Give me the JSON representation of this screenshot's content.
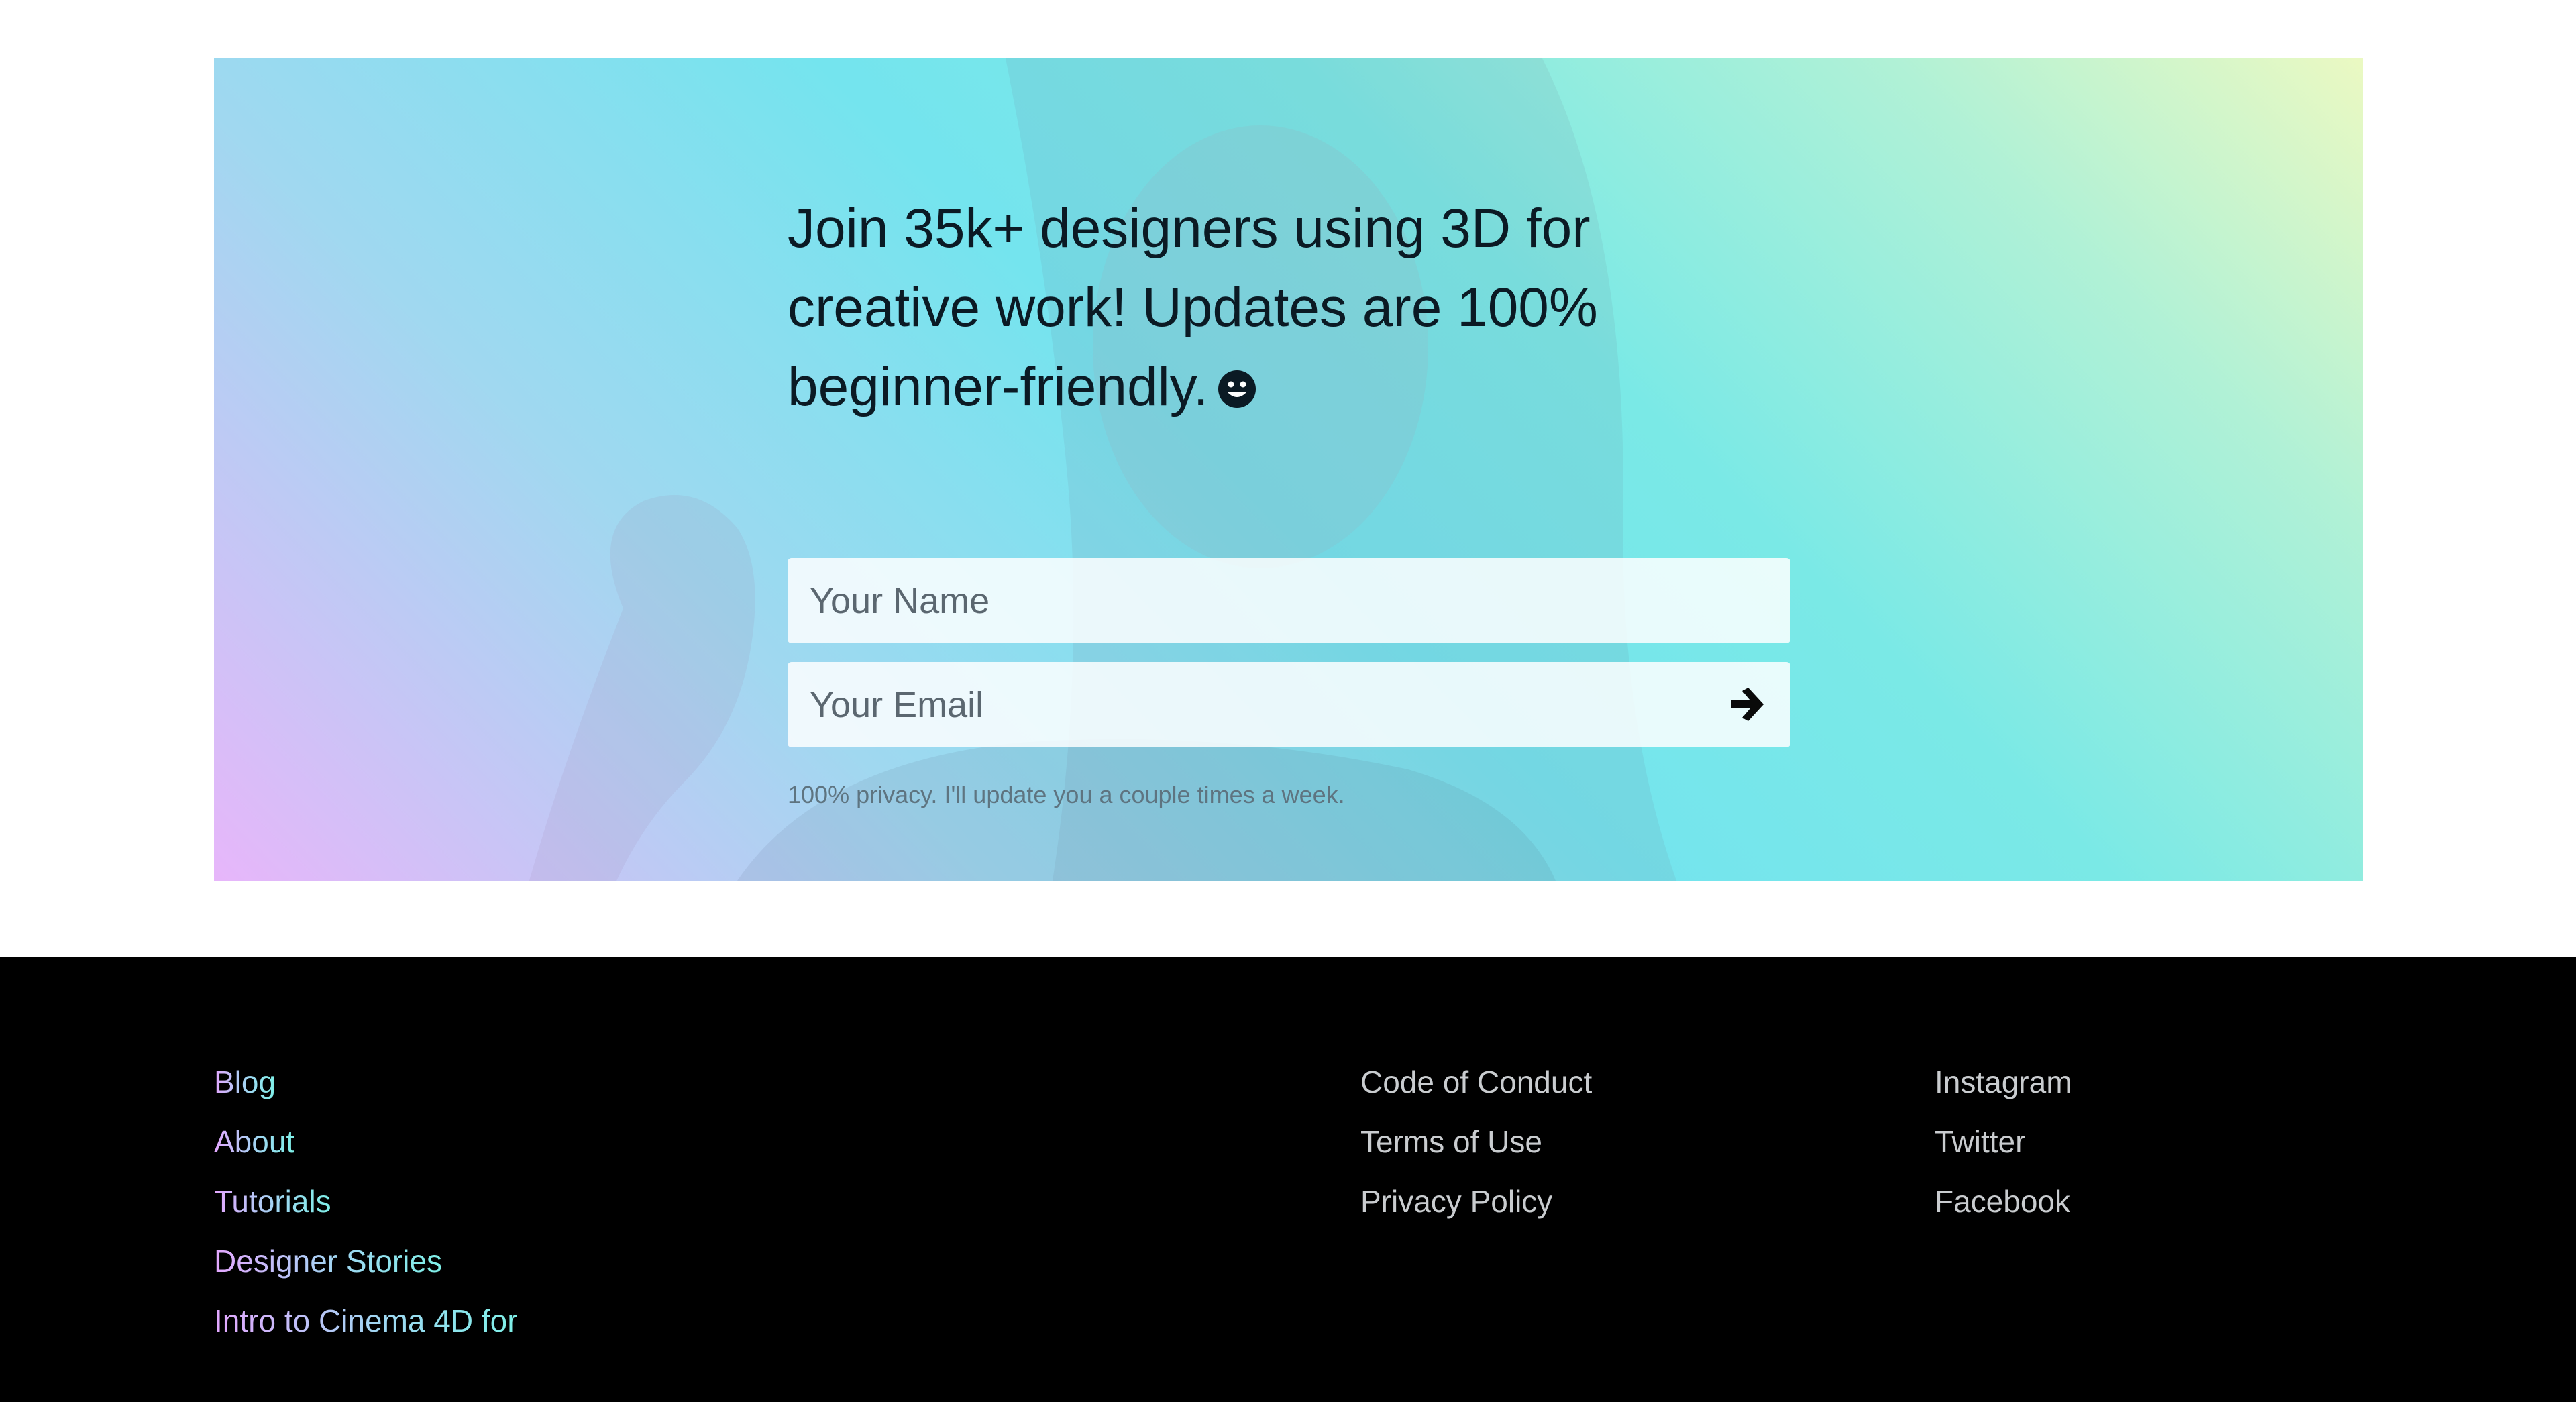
{
  "signup": {
    "headline": "Join 35k+ designers using 3D for creative work! Updates are 100% beginner-friendly.",
    "name_placeholder": "Your Name",
    "email_placeholder": "Your Email",
    "submit_icon": "arrow-right-icon",
    "privacy_note": "100% privacy. I'll update you a couple times a week.",
    "emoji_icon": "smiling-face-icon"
  },
  "footer": {
    "primary_links": [
      {
        "label": "Blog"
      },
      {
        "label": "About"
      },
      {
        "label": "Tutorials"
      },
      {
        "label": "Designer Stories"
      },
      {
        "label": "Intro to Cinema 4D for"
      }
    ],
    "legal_links": [
      {
        "label": "Code of Conduct"
      },
      {
        "label": "Terms of Use"
      },
      {
        "label": "Privacy Policy"
      }
    ],
    "social_links": [
      {
        "label": "Instagram"
      },
      {
        "label": "Twitter"
      },
      {
        "label": "Facebook"
      }
    ]
  },
  "colors": {
    "gradient_pink": "#e7b6fa",
    "gradient_cyan": "#74e4ee",
    "gradient_lime": "#ebf9c2",
    "footer_bg": "#000000",
    "footer_link": "#c9cccf"
  }
}
